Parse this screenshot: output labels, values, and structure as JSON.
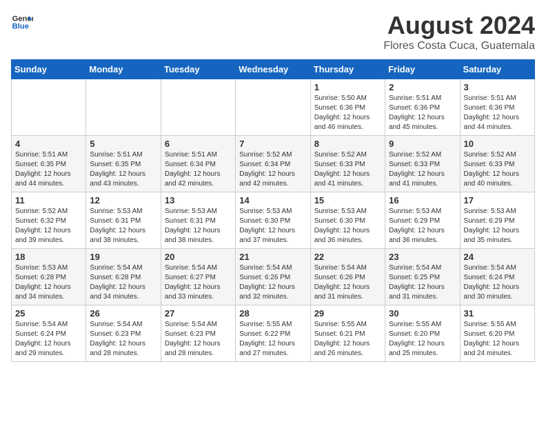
{
  "header": {
    "logo_line1": "General",
    "logo_line2": "Blue",
    "title": "August 2024",
    "subtitle": "Flores Costa Cuca, Guatemala"
  },
  "weekdays": [
    "Sunday",
    "Monday",
    "Tuesday",
    "Wednesday",
    "Thursday",
    "Friday",
    "Saturday"
  ],
  "weeks": [
    [
      {
        "day": "",
        "info": ""
      },
      {
        "day": "",
        "info": ""
      },
      {
        "day": "",
        "info": ""
      },
      {
        "day": "",
        "info": ""
      },
      {
        "day": "1",
        "info": "Sunrise: 5:50 AM\nSunset: 6:36 PM\nDaylight: 12 hours\nand 46 minutes."
      },
      {
        "day": "2",
        "info": "Sunrise: 5:51 AM\nSunset: 6:36 PM\nDaylight: 12 hours\nand 45 minutes."
      },
      {
        "day": "3",
        "info": "Sunrise: 5:51 AM\nSunset: 6:36 PM\nDaylight: 12 hours\nand 44 minutes."
      }
    ],
    [
      {
        "day": "4",
        "info": "Sunrise: 5:51 AM\nSunset: 6:35 PM\nDaylight: 12 hours\nand 44 minutes."
      },
      {
        "day": "5",
        "info": "Sunrise: 5:51 AM\nSunset: 6:35 PM\nDaylight: 12 hours\nand 43 minutes."
      },
      {
        "day": "6",
        "info": "Sunrise: 5:51 AM\nSunset: 6:34 PM\nDaylight: 12 hours\nand 42 minutes."
      },
      {
        "day": "7",
        "info": "Sunrise: 5:52 AM\nSunset: 6:34 PM\nDaylight: 12 hours\nand 42 minutes."
      },
      {
        "day": "8",
        "info": "Sunrise: 5:52 AM\nSunset: 6:33 PM\nDaylight: 12 hours\nand 41 minutes."
      },
      {
        "day": "9",
        "info": "Sunrise: 5:52 AM\nSunset: 6:33 PM\nDaylight: 12 hours\nand 41 minutes."
      },
      {
        "day": "10",
        "info": "Sunrise: 5:52 AM\nSunset: 6:33 PM\nDaylight: 12 hours\nand 40 minutes."
      }
    ],
    [
      {
        "day": "11",
        "info": "Sunrise: 5:52 AM\nSunset: 6:32 PM\nDaylight: 12 hours\nand 39 minutes."
      },
      {
        "day": "12",
        "info": "Sunrise: 5:53 AM\nSunset: 6:31 PM\nDaylight: 12 hours\nand 38 minutes."
      },
      {
        "day": "13",
        "info": "Sunrise: 5:53 AM\nSunset: 6:31 PM\nDaylight: 12 hours\nand 38 minutes."
      },
      {
        "day": "14",
        "info": "Sunrise: 5:53 AM\nSunset: 6:30 PM\nDaylight: 12 hours\nand 37 minutes."
      },
      {
        "day": "15",
        "info": "Sunrise: 5:53 AM\nSunset: 6:30 PM\nDaylight: 12 hours\nand 36 minutes."
      },
      {
        "day": "16",
        "info": "Sunrise: 5:53 AM\nSunset: 6:29 PM\nDaylight: 12 hours\nand 36 minutes."
      },
      {
        "day": "17",
        "info": "Sunrise: 5:53 AM\nSunset: 6:29 PM\nDaylight: 12 hours\nand 35 minutes."
      }
    ],
    [
      {
        "day": "18",
        "info": "Sunrise: 5:53 AM\nSunset: 6:28 PM\nDaylight: 12 hours\nand 34 minutes."
      },
      {
        "day": "19",
        "info": "Sunrise: 5:54 AM\nSunset: 6:28 PM\nDaylight: 12 hours\nand 34 minutes."
      },
      {
        "day": "20",
        "info": "Sunrise: 5:54 AM\nSunset: 6:27 PM\nDaylight: 12 hours\nand 33 minutes."
      },
      {
        "day": "21",
        "info": "Sunrise: 5:54 AM\nSunset: 6:26 PM\nDaylight: 12 hours\nand 32 minutes."
      },
      {
        "day": "22",
        "info": "Sunrise: 5:54 AM\nSunset: 6:26 PM\nDaylight: 12 hours\nand 31 minutes."
      },
      {
        "day": "23",
        "info": "Sunrise: 5:54 AM\nSunset: 6:25 PM\nDaylight: 12 hours\nand 31 minutes."
      },
      {
        "day": "24",
        "info": "Sunrise: 5:54 AM\nSunset: 6:24 PM\nDaylight: 12 hours\nand 30 minutes."
      }
    ],
    [
      {
        "day": "25",
        "info": "Sunrise: 5:54 AM\nSunset: 6:24 PM\nDaylight: 12 hours\nand 29 minutes."
      },
      {
        "day": "26",
        "info": "Sunrise: 5:54 AM\nSunset: 6:23 PM\nDaylight: 12 hours\nand 28 minutes."
      },
      {
        "day": "27",
        "info": "Sunrise: 5:54 AM\nSunset: 6:23 PM\nDaylight: 12 hours\nand 28 minutes."
      },
      {
        "day": "28",
        "info": "Sunrise: 5:55 AM\nSunset: 6:22 PM\nDaylight: 12 hours\nand 27 minutes."
      },
      {
        "day": "29",
        "info": "Sunrise: 5:55 AM\nSunset: 6:21 PM\nDaylight: 12 hours\nand 26 minutes."
      },
      {
        "day": "30",
        "info": "Sunrise: 5:55 AM\nSunset: 6:20 PM\nDaylight: 12 hours\nand 25 minutes."
      },
      {
        "day": "31",
        "info": "Sunrise: 5:55 AM\nSunset: 6:20 PM\nDaylight: 12 hours\nand 24 minutes."
      }
    ]
  ]
}
